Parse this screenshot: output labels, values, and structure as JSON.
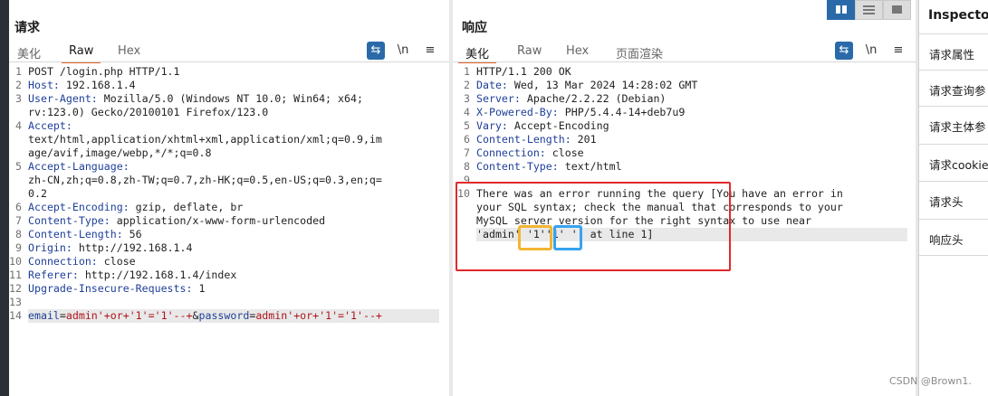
{
  "request": {
    "title": "请求",
    "tabs": [
      "美化",
      "Raw",
      "Hex"
    ],
    "active_tab": "Raw",
    "tools": {
      "wrap": "⇆",
      "newline": "\\n",
      "menu": "≡"
    },
    "lines": [
      {
        "n": "1",
        "key": "",
        "text": "POST /login.php HTTP/1.1"
      },
      {
        "n": "2",
        "key": "Host:",
        "text": " 192.168.1.4"
      },
      {
        "n": "3",
        "key": "User-Agent:",
        "text": " Mozilla/5.0 (Windows NT 10.0; Win64; x64;"
      },
      {
        "n": "",
        "key": "",
        "text": "rv:123.0) Gecko/20100101 Firefox/123.0"
      },
      {
        "n": "4",
        "key": "Accept:",
        "text": ""
      },
      {
        "n": "",
        "key": "",
        "text": "text/html,application/xhtml+xml,application/xml;q=0.9,im"
      },
      {
        "n": "",
        "key": "",
        "text": "age/avif,image/webp,*/*;q=0.8"
      },
      {
        "n": "5",
        "key": "Accept-Language:",
        "text": ""
      },
      {
        "n": "",
        "key": "",
        "text": "zh-CN,zh;q=0.8,zh-TW;q=0.7,zh-HK;q=0.5,en-US;q=0.3,en;q="
      },
      {
        "n": "",
        "key": "",
        "text": "0.2"
      },
      {
        "n": "6",
        "key": "Accept-Encoding:",
        "text": " gzip, deflate, br"
      },
      {
        "n": "7",
        "key": "Content-Type:",
        "text": " application/x-www-form-urlencoded"
      },
      {
        "n": "8",
        "key": "Content-Length:",
        "text": " 56"
      },
      {
        "n": "9",
        "key": "Origin:",
        "text": " http://192.168.1.4"
      },
      {
        "n": "10",
        "key": "Connection:",
        "text": " close"
      },
      {
        "n": "11",
        "key": "Referer:",
        "text": " http://192.168.1.4/index"
      },
      {
        "n": "12",
        "key": "Upgrade-Insecure-Requests:",
        "text": " 1"
      },
      {
        "n": "13",
        "key": "",
        "text": ""
      }
    ],
    "body_line": {
      "n": "14",
      "p1_name": "email",
      "eq1": "=",
      "p1_val": "admin'+or+'1'='1'--+",
      "amp": "&",
      "p2_name": "password",
      "eq2": "=",
      "p2_val": "admin'+or+'1'='1'--+"
    }
  },
  "response": {
    "title": "响应",
    "tabs": [
      "美化",
      "Raw",
      "Hex",
      "页面渲染"
    ],
    "active_tab": "美化",
    "tools": {
      "wrap": "⇆",
      "newline": "\\n",
      "menu": "≡"
    },
    "lines": [
      {
        "n": "1",
        "key": "",
        "text": "HTTP/1.1 200 OK"
      },
      {
        "n": "2",
        "key": "Date:",
        "text": " Wed, 13 Mar 2024 14:28:02 GMT"
      },
      {
        "n": "3",
        "key": "Server:",
        "text": " Apache/2.2.22 (Debian)"
      },
      {
        "n": "4",
        "key": "X-Powered-By:",
        "text": " PHP/5.4.4-14+deb7u9"
      },
      {
        "n": "5",
        "key": "Vary:",
        "text": " Accept-Encoding"
      },
      {
        "n": "6",
        "key": "Content-Length:",
        "text": " 201"
      },
      {
        "n": "7",
        "key": "Connection:",
        "text": " close"
      },
      {
        "n": "8",
        "key": "Content-Type:",
        "text": " text/html"
      },
      {
        "n": "9",
        "key": "",
        "text": ""
      },
      {
        "n": "10",
        "key": "",
        "text": "There was an error running the query [You have an error in"
      },
      {
        "n": "",
        "key": "",
        "text": "your SQL syntax; check the manual that corresponds to your"
      },
      {
        "n": "",
        "key": "",
        "text": "MySQL server version for the right syntax to use near"
      },
      {
        "n": "",
        "key": "",
        "text": "'admin' '1''1' '' at line 1]"
      }
    ]
  },
  "inspector": {
    "title": "Inspecto",
    "items": [
      "请求属性",
      "请求查询参",
      "请求主体参",
      "请求cookie",
      "请求头",
      "响应头"
    ]
  },
  "watermark": "CSDN @Brown1.",
  "colors": {
    "accent": "#2b6aa9",
    "tab_underline": "#e8622a",
    "annotation_red": "#e02a2a",
    "annotation_yellow": "#f3b531",
    "annotation_blue": "#36a3f0"
  }
}
